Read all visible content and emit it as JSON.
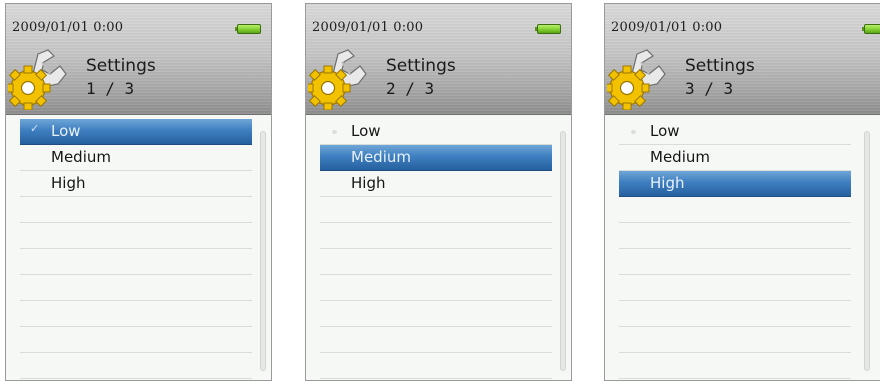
{
  "screens": [
    {
      "datetime": "2009/01/01  0:00",
      "title": "Settings",
      "page": "1 / 3",
      "items": [
        {
          "label": "Low",
          "selected": true,
          "checked": true
        },
        {
          "label": "Medium",
          "selected": false,
          "checked": false
        },
        {
          "label": "High",
          "selected": false,
          "checked": false
        }
      ]
    },
    {
      "datetime": "2009/01/01  0:00",
      "title": "Settings",
      "page": "2 / 3",
      "items": [
        {
          "label": "Low",
          "selected": false,
          "checked": true
        },
        {
          "label": "Medium",
          "selected": true,
          "checked": false
        },
        {
          "label": "High",
          "selected": false,
          "checked": false
        }
      ]
    },
    {
      "datetime": "2009/01/01  0:00",
      "title": "Settings",
      "page": "3 / 3",
      "items": [
        {
          "label": "Low",
          "selected": false,
          "checked": true
        },
        {
          "label": "Medium",
          "selected": false,
          "checked": false
        },
        {
          "label": "High",
          "selected": true,
          "checked": false
        }
      ]
    }
  ],
  "icons": {
    "battery": "battery-full-icon",
    "settings": "settings-gear-wrench-icon",
    "check": "checkmark-icon",
    "bullet": "bullet-icon"
  },
  "colors": {
    "selection": "#2f6eb0",
    "battery": "#7fcc2c",
    "gear": "#f2c200"
  },
  "glyphs": {
    "check": "✓"
  }
}
